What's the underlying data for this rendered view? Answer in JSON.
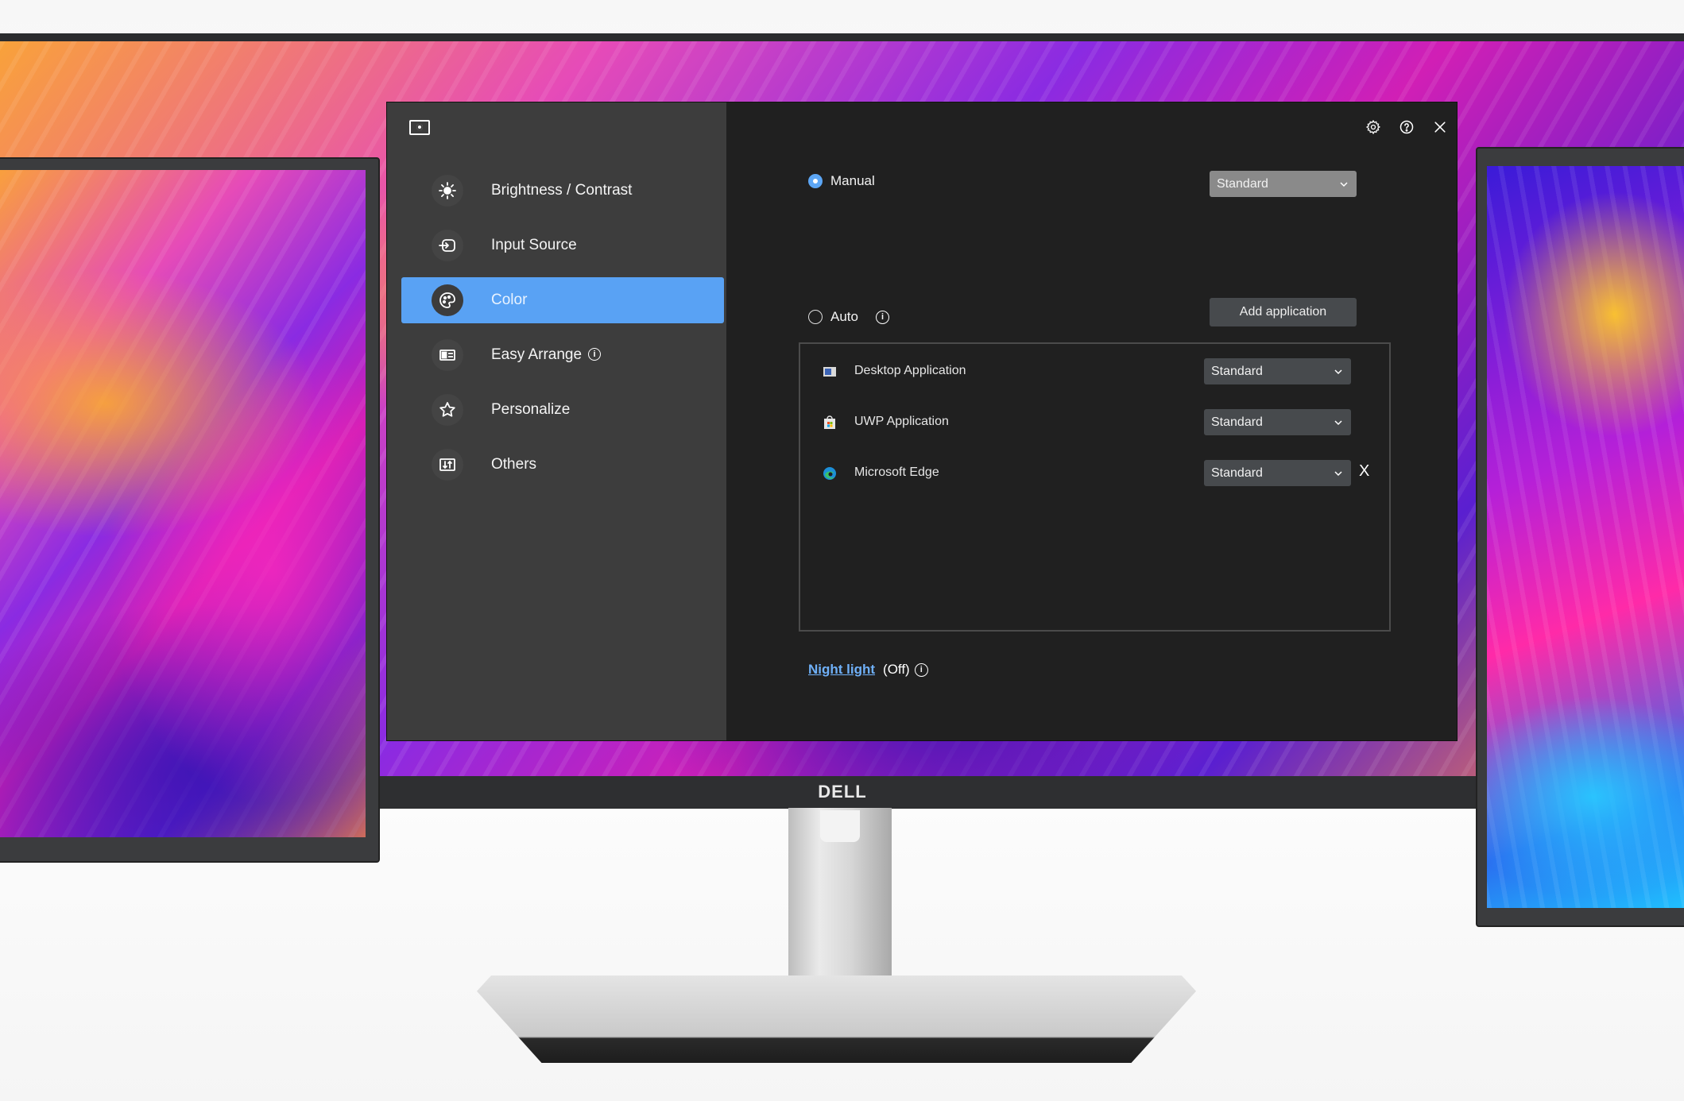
{
  "window": {
    "app_logo": "monitor-settings-icon",
    "top_icons": [
      {
        "name": "settings",
        "icon": "gear-icon"
      },
      {
        "name": "help",
        "icon": "help-icon"
      },
      {
        "name": "close",
        "icon": "close-icon"
      }
    ]
  },
  "sidebar": {
    "items": [
      {
        "label": "Brightness / Contrast",
        "icon": "brightness-icon",
        "active": false
      },
      {
        "label": "Input Source",
        "icon": "input-source-icon",
        "active": false
      },
      {
        "label": "Color",
        "icon": "palette-icon",
        "active": true
      },
      {
        "label": "Easy Arrange",
        "icon": "layout-icon",
        "active": false,
        "info": "i"
      },
      {
        "label": "Personalize",
        "icon": "star-icon",
        "active": false
      },
      {
        "label": "Others",
        "icon": "others-icon",
        "active": false
      }
    ]
  },
  "color": {
    "manual": {
      "label": "Manual",
      "selected": true,
      "preset": "Standard"
    },
    "auto": {
      "label": "Auto",
      "selected": false,
      "info": "i"
    },
    "add_application_label": "Add application",
    "applications": [
      {
        "name": "Desktop Application",
        "icon": "desktop-app-icon",
        "preset": "Standard",
        "removable": false
      },
      {
        "name": "UWP Application",
        "icon": "store-app-icon",
        "preset": "Standard",
        "removable": false
      },
      {
        "name": "Microsoft Edge",
        "icon": "edge-icon",
        "preset": "Standard",
        "removable": true,
        "remove_label": "X"
      }
    ],
    "night_light": {
      "label": "Night light",
      "status": "(Off)",
      "info": "i"
    }
  },
  "monitor": {
    "brand": "DELL"
  },
  "colors": {
    "accent": "#59a2f4",
    "sidebar_bg": "#3d3d3d",
    "content_bg": "#202020",
    "link": "#6fb0f8"
  }
}
